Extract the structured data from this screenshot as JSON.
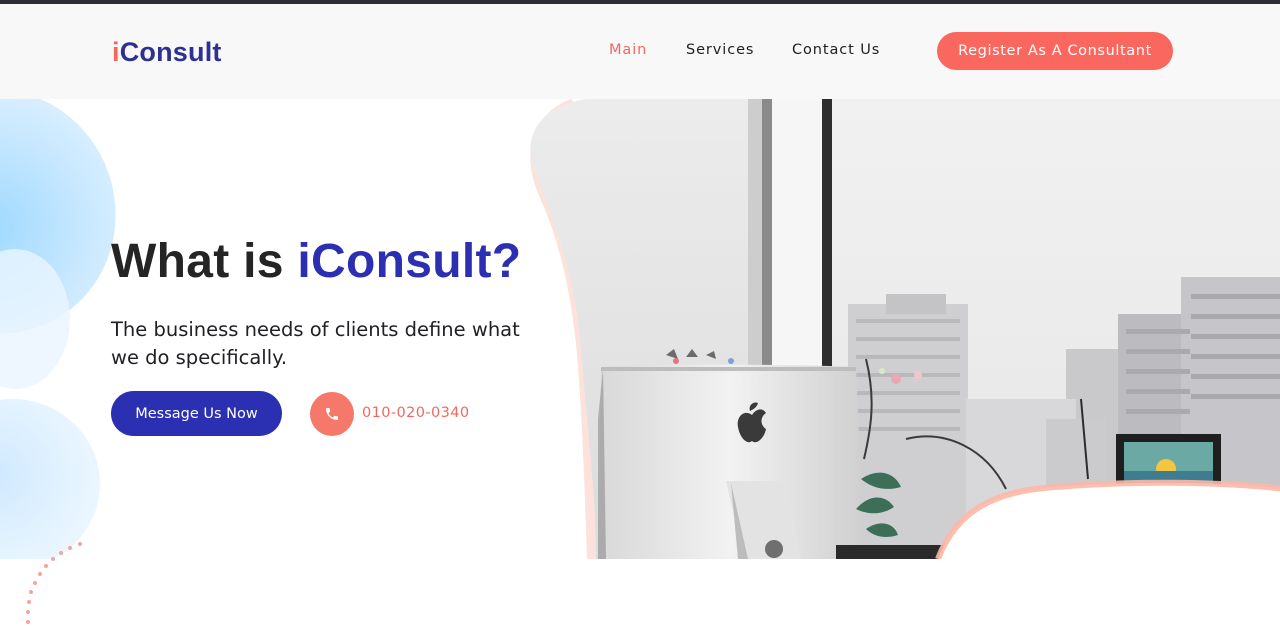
{
  "header": {
    "logo_i": "i",
    "logo_rest": "Consult",
    "nav": [
      "Main",
      "Services",
      "Contact Us"
    ],
    "active_nav": "Main",
    "register_label": "Register As A Consultant"
  },
  "hero": {
    "title_plain": "What is ",
    "title_accent": "iConsult?",
    "description": "The business needs of clients define what we do specifically.",
    "message_button": "Message Us Now",
    "phone_icon": "phone-icon",
    "phone_number": "010-020-0340"
  },
  "colors": {
    "brand_blue": "#2c2fb1",
    "accent_coral": "#f2685f",
    "text_dark": "#242424",
    "header_bg": "#f8f8f9"
  }
}
